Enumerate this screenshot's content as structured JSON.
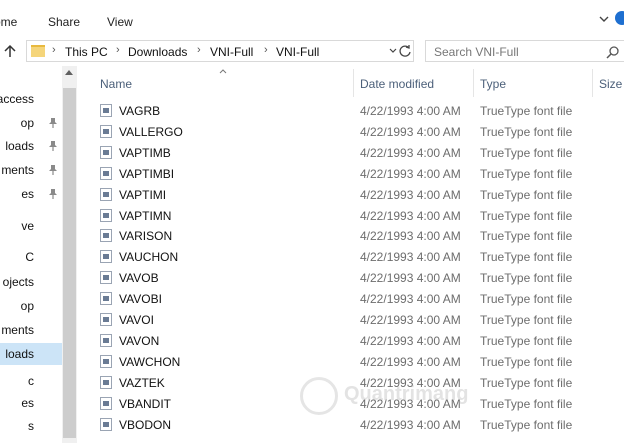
{
  "ribbon": {
    "tabs": [
      "ome",
      "Share",
      "View"
    ]
  },
  "address": {
    "crumbs": [
      "This PC",
      "Downloads",
      "VNI-Full",
      "VNI-Full"
    ]
  },
  "search": {
    "placeholder": "Search VNI-Full"
  },
  "nav": {
    "items": [
      {
        "label": "access",
        "pinned": false,
        "selected": false
      },
      {
        "label": "op",
        "pinned": true,
        "selected": false
      },
      {
        "label": "loads",
        "pinned": true,
        "selected": false
      },
      {
        "label": "ments",
        "pinned": true,
        "selected": false
      },
      {
        "label": "es",
        "pinned": true,
        "selected": false
      },
      {
        "label": "ve",
        "pinned": false,
        "selected": false
      },
      {
        "label": "C",
        "pinned": false,
        "selected": false
      },
      {
        "label": "ojects",
        "pinned": false,
        "selected": false
      },
      {
        "label": "op",
        "pinned": false,
        "selected": false
      },
      {
        "label": "ments",
        "pinned": false,
        "selected": false
      },
      {
        "label": "loads",
        "pinned": false,
        "selected": true
      },
      {
        "label": "c",
        "pinned": false,
        "selected": false
      },
      {
        "label": "es",
        "pinned": false,
        "selected": false
      },
      {
        "label": "s",
        "pinned": false,
        "selected": false
      }
    ]
  },
  "columns": {
    "name": "Name",
    "date": "Date modified",
    "type": "Type",
    "size": "Size"
  },
  "files": [
    {
      "name": "VAGRB",
      "date": "4/22/1993 4:00 AM",
      "type": "TrueType font file"
    },
    {
      "name": "VALLERGO",
      "date": "4/22/1993 4:00 AM",
      "type": "TrueType font file"
    },
    {
      "name": "VAPTIMB",
      "date": "4/22/1993 4:00 AM",
      "type": "TrueType font file"
    },
    {
      "name": "VAPTIMBI",
      "date": "4/22/1993 4:00 AM",
      "type": "TrueType font file"
    },
    {
      "name": "VAPTIMI",
      "date": "4/22/1993 4:00 AM",
      "type": "TrueType font file"
    },
    {
      "name": "VAPTIMN",
      "date": "4/22/1993 4:00 AM",
      "type": "TrueType font file"
    },
    {
      "name": "VARISON",
      "date": "4/22/1993 4:00 AM",
      "type": "TrueType font file"
    },
    {
      "name": "VAUCHON",
      "date": "4/22/1993 4:00 AM",
      "type": "TrueType font file"
    },
    {
      "name": "VAVOB",
      "date": "4/22/1993 4:00 AM",
      "type": "TrueType font file"
    },
    {
      "name": "VAVOBI",
      "date": "4/22/1993 4:00 AM",
      "type": "TrueType font file"
    },
    {
      "name": "VAVOI",
      "date": "4/22/1993 4:00 AM",
      "type": "TrueType font file"
    },
    {
      "name": "VAVON",
      "date": "4/22/1993 4:00 AM",
      "type": "TrueType font file"
    },
    {
      "name": "VAWCHON",
      "date": "4/22/1993 4:00 AM",
      "type": "TrueType font file"
    },
    {
      "name": "VAZTEK",
      "date": "4/22/1993 4:00 AM",
      "type": "TrueType font file"
    },
    {
      "name": "VBANDIT",
      "date": "4/22/1993 4:00 AM",
      "type": "TrueType font file"
    },
    {
      "name": "VBODON",
      "date": "4/22/1993 4:00 AM",
      "type": "TrueType font file"
    }
  ],
  "watermark": {
    "text": "Quantrimang"
  },
  "colors": {
    "selection": "#cce4f7",
    "header_text": "#4c607a",
    "help_icon": "#1e6fd0"
  }
}
